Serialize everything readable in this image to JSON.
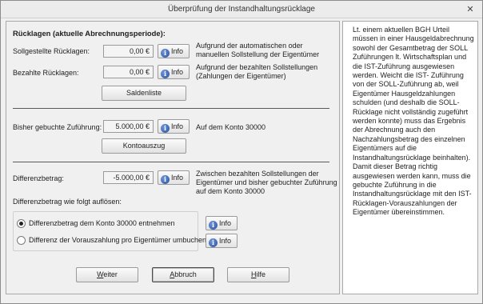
{
  "window": {
    "title": "Überprüfung der Instandhaltungsrücklage",
    "close_glyph": "✕"
  },
  "section_title": "Rücklagen (aktuelle Abrechnungsperiode):",
  "rows": {
    "soll": {
      "label": "Sollgestellte Rücklagen:",
      "value": "0,00 €",
      "desc": "Aufgrund der automatischen oder manuellen Sollstellung der Eigentümer"
    },
    "bezahlt": {
      "label": "Bezahlte Rücklagen:",
      "value": "0,00 €",
      "desc": "Aufgrund der bezahlten Sollstellungen (Zahlungen der Eigentümer)"
    },
    "gebucht": {
      "label": "Bisher gebuchte Zuführung:",
      "value": "5.000,00 €",
      "desc": "Auf dem Konto 30000"
    },
    "differenz": {
      "label": "Differenzbetrag:",
      "value": "-5.000,00 €",
      "desc": "Zwischen bezahlten Sollstellungen der Eigentümer und bisher gebuchter Zuführung auf dem Konto 30000"
    }
  },
  "info_label": "Info",
  "buttons": {
    "saldenliste": "Saldenliste",
    "kontoauszug": "Kontoauszug",
    "weiter_first": "W",
    "weiter_rest": "eiter",
    "abbruch_first": "A",
    "abbruch_rest": "bbruch",
    "hilfe_first": "H",
    "hilfe_rest": "ilfe"
  },
  "resolve": {
    "heading": "Differenzbetrag wie folgt auflösen:",
    "options": [
      {
        "label": "Differenzbetrag dem Konto 30000 entnehmen",
        "checked": true
      },
      {
        "label": "Differenz der Vorauszahlung pro Eigentümer umbuchen",
        "checked": false
      }
    ]
  },
  "side_text": "Lt. einem aktuellen BGH Urteil müssen in einer Hausgeldabrechnung sowohl der Gesamtbetrag der SOLL Zuführungen lt. Wirtschaftsplan und die IST-Zuführung ausgewiesen werden. Weicht die IST- Zuführung von der SOLL-Zuführung ab, weil Eigentümer Hausgeldzahlungen schulden (und deshalb die SOLL-Rücklage nicht vollständig zugeführt werden konnte) muss das Ergebnis der Abrechnung auch den Nachzahlungsbetrag des einzelnen Eigentümers auf die Instandhaltungsrücklage beinhalten). Damit dieser Betrag richtig ausgewiesen werden kann, muss die gebuchte Zuführung in die Instandhaltungsrücklage mit den IST-Rücklagen-Vorauszahlungen der Eigentümer übereinstimmen.",
  "icons": {
    "info": "info-icon",
    "close": "close-icon"
  },
  "colors": {
    "info_icon": "#2a4fa0",
    "panel_bg": "#f0f0f0",
    "side_bg": "#ffffff"
  }
}
